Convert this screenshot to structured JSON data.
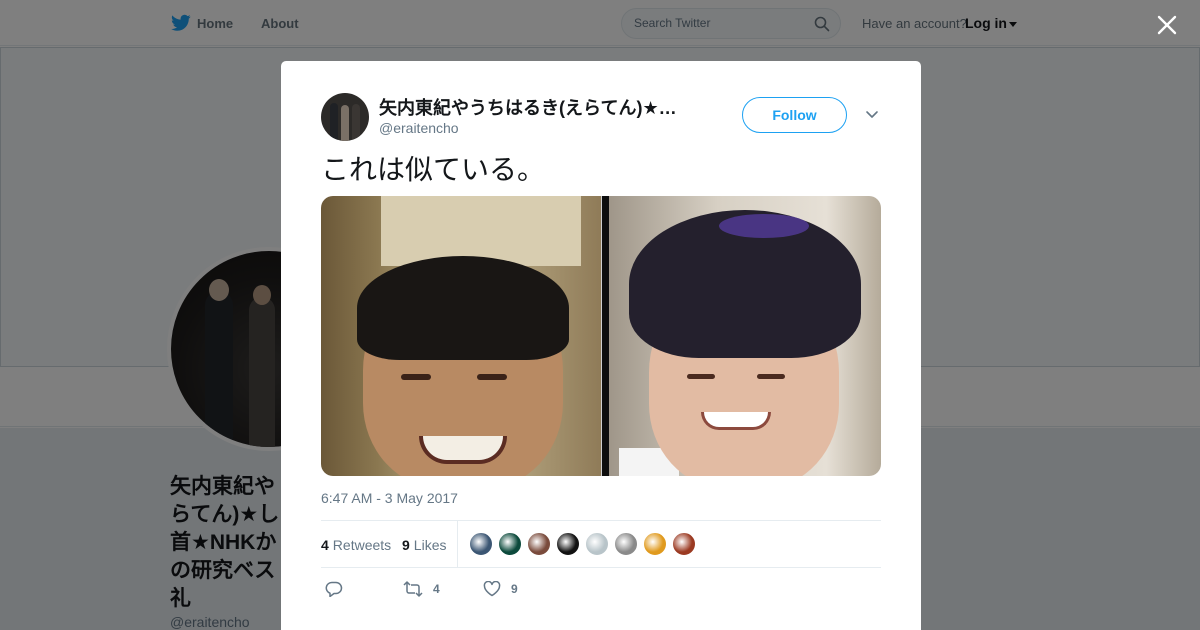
{
  "nav": {
    "home": "Home",
    "about": "About",
    "search_placeholder": "Search Twitter",
    "have_account": "Have an account?",
    "login": "Log in"
  },
  "profile": {
    "name_visible": "矢内東紀や\nらてん)★し\n首★NHKか\nの研究ベス\n礼",
    "handle": "@eraitencho"
  },
  "tweet": {
    "author_name": "矢内東紀やうちはるき(えらてん)★…",
    "author_handle": "@eraitencho",
    "follow_label": "Follow",
    "text": "これは似ている。",
    "timestamp": "6:47 AM - 3 May 2017",
    "retweets_count": "4",
    "retweets_label": "Retweets",
    "likes_count": "9",
    "likes_label": "Likes",
    "likers": [
      "#3b5673",
      "#0c4a3c",
      "#7a4b3c",
      "#111111",
      "#b8c4c9",
      "#8a8a8a",
      "#e09a1e",
      "#9b3a22"
    ],
    "reply_count": "",
    "retweet_action_count": "4",
    "like_action_count": "9"
  },
  "colors": {
    "accent": "#1da1f2",
    "text": "#14171a",
    "muted": "#657786"
  }
}
